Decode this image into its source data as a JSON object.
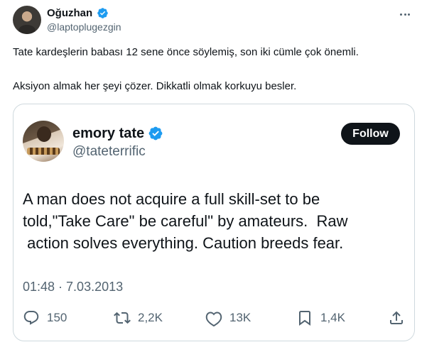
{
  "outer_tweet": {
    "author_name": "Oğuzhan",
    "author_handle": "@laptoplugezgin",
    "text_line1": "Tate kardeşlerin babası 12 sene önce söylemiş, son iki cümle çok önemli.",
    "text_line2": "Aksiyon almak her şeyi çözer. Dikkatli olmak korkuyu besler."
  },
  "quoted_tweet": {
    "author_name": "emory tate",
    "author_handle": "@tateterrific",
    "follow_label": "Follow",
    "body_lines": [
      "A man does not acquire a full skill-set to be",
      "told,\"Take Care\" be careful\" by amateurs.  Raw",
      " action solves everything. Caution breeds fear."
    ],
    "timestamp": "01:48 · 7.03.2013",
    "stats": {
      "replies": "150",
      "retweets": "2,2K",
      "likes": "13K",
      "bookmarks": "1,4K"
    }
  },
  "icons": {
    "verified": "verified-badge-icon",
    "more": "more-icon",
    "reply": "reply-icon",
    "retweet": "retweet-icon",
    "like": "heart-icon",
    "bookmark": "bookmark-icon",
    "share": "share-icon"
  },
  "colors": {
    "verified_blue": "#1d9bf0",
    "text_primary": "#0f1419",
    "text_secondary": "#536471",
    "border": "#cfd9de",
    "follow_bg": "#0f1419"
  }
}
